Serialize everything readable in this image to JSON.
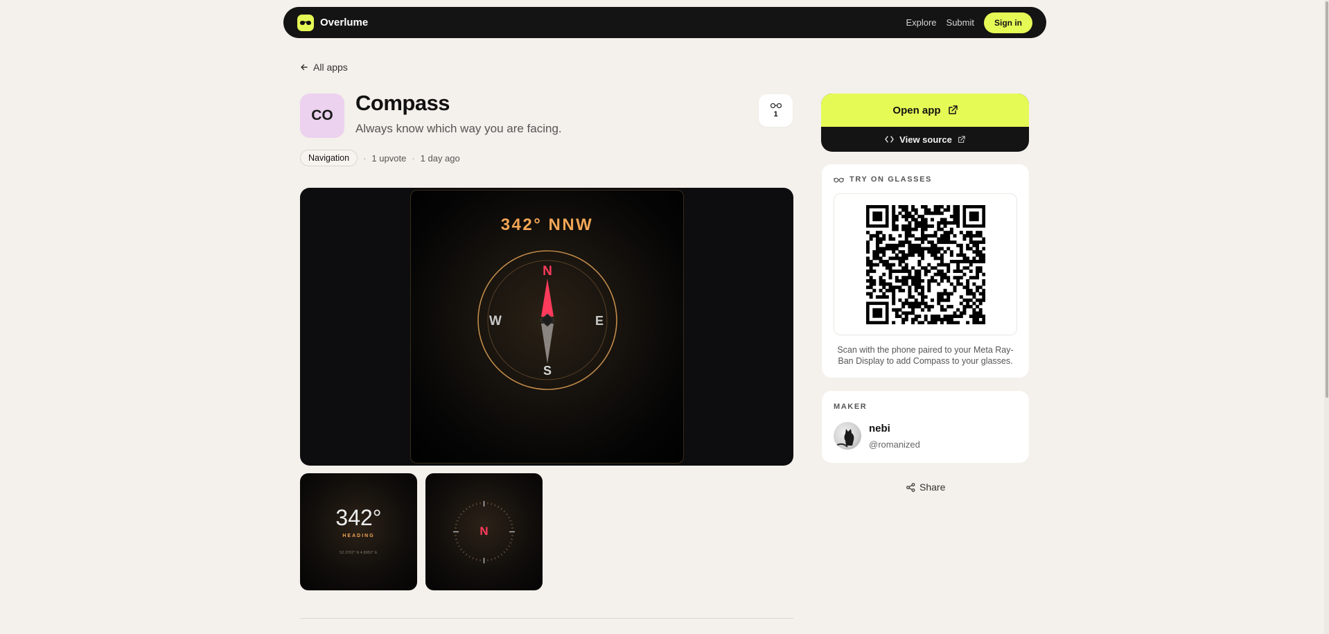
{
  "nav": {
    "brand": "Overlume",
    "links": [
      "Explore",
      "Submit"
    ],
    "signin": "Sign in",
    "accent": "#e6fa56"
  },
  "back_label": "All apps",
  "app": {
    "icon_text": "CO",
    "icon_bg": "#ecd2ef",
    "name": "Compass",
    "tagline": "Always know which way you are facing.",
    "upvotes": "1",
    "category": "Navigation",
    "upvote_text": "1 upvote",
    "age": "1 day ago"
  },
  "hero": {
    "heading": "342° NNW",
    "cardinals": {
      "n": "N",
      "e": "E",
      "s": "S",
      "w": "W"
    },
    "needle_color": "#ff3b5c",
    "ring_color": "#c08a4a"
  },
  "thumbs": [
    {
      "degrees": "342°",
      "label": "HEADING",
      "coords": "52.3702° N 4.8952° E"
    },
    {
      "north": "N"
    }
  ],
  "actions": {
    "open_app": "Open app",
    "view_source": "View source"
  },
  "try_on": {
    "label": "TRY ON GLASSES",
    "caption": "Scan with the phone paired to your Meta Ray-Ban Display to add Compass to your glasses."
  },
  "maker": {
    "label": "MAKER",
    "name": "nebi",
    "handle": "@romanized"
  },
  "share_label": "Share"
}
